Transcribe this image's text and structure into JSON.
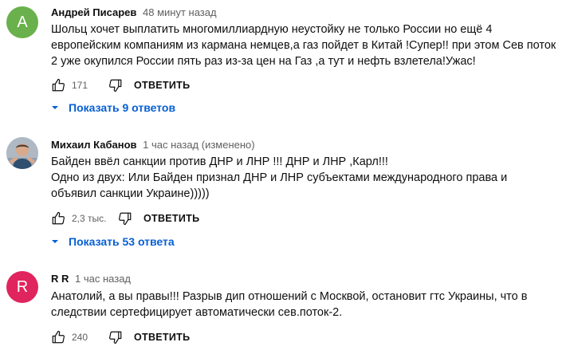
{
  "comments": [
    {
      "avatar_letter": "A",
      "avatar_color": "#6ab04c",
      "author": "Андрей Писарев",
      "time": "48 минут назад",
      "text": "Шольц хочет выплатить многомиллиардную неустойку не только России но ещё 4\nевропейским компаниям из кармана немцев,а газ пойдет в Китай !Супер!! при этом Сев поток\n2 уже окупился России пять раз из-за цен на Газ ,а тут и нефть взлетела!Ужас!",
      "likes": "171",
      "reply_label": "ОТВЕТИТЬ",
      "replies_label": "Показать 9 ответов"
    },
    {
      "avatar_letter": "",
      "avatar_color": "#9aa8b6",
      "author": "Михаил Кабанов",
      "time": "1 час назад (изменено)",
      "text": "Байден ввёл санкции против ДНР и ЛНР !!!   ДНР и ЛНР ,Карл!!!\nОдно из двух: Или Байден признал ДНР и ЛНР субъектами международного права и\nобъявил  санкции  Украине)))))",
      "likes": "2,3 тыс.",
      "reply_label": "ОТВЕТИТЬ",
      "replies_label": "Показать 53 ответа"
    },
    {
      "avatar_letter": "R",
      "avatar_color": "#e0245e",
      "author": "R R",
      "time": "1 час назад",
      "text": "Анатолий, а вы правы!!! Разрыв дип отношений с Москвой, остановит гтс Украины, что в\nследствии сертефицирует автоматически сев.поток-2.",
      "likes": "240",
      "reply_label": "ОТВЕТИТЬ"
    }
  ],
  "icons": {
    "like": "thumb-up-icon",
    "dislike": "thumb-down-icon",
    "expand": "caret-down-icon"
  },
  "colors": {
    "link_blue": "#065fd4",
    "meta_gray": "#606060"
  }
}
